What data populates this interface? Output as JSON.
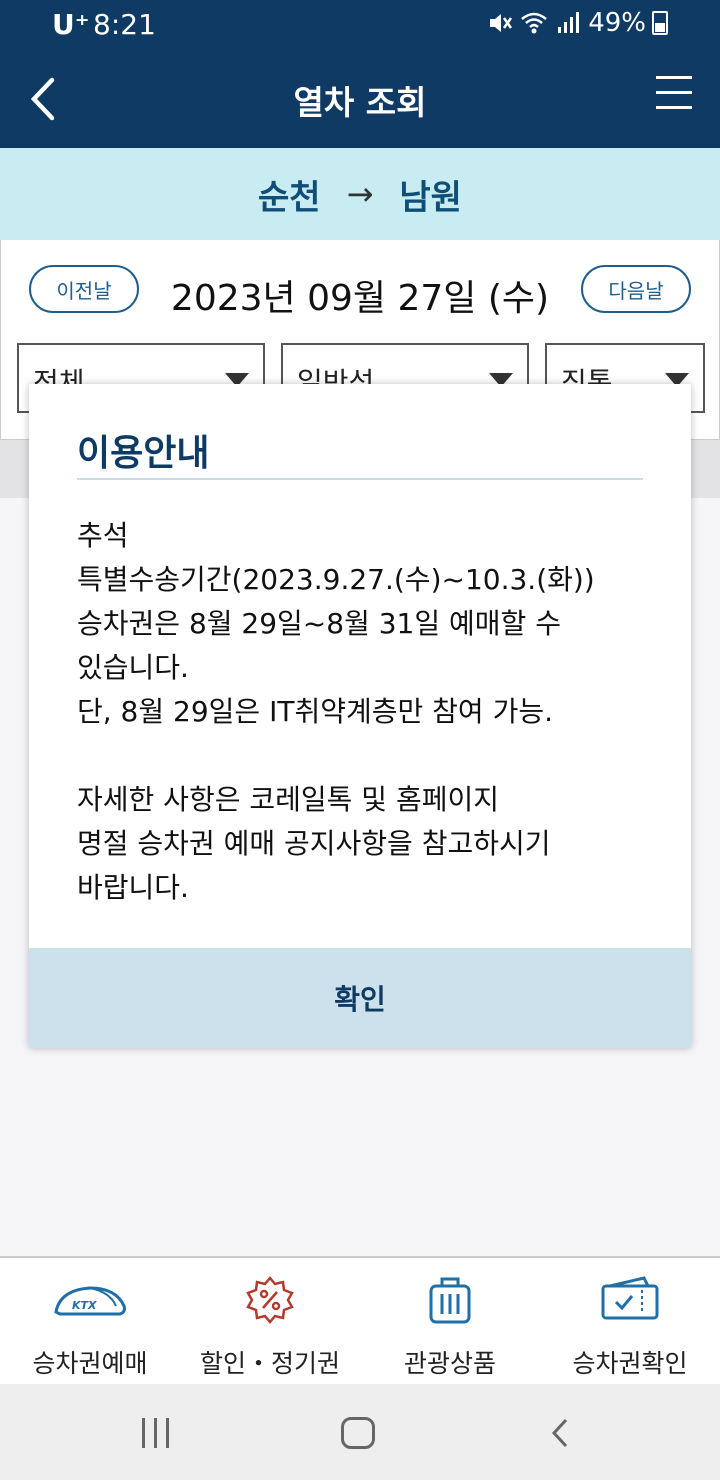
{
  "status_bar": {
    "carrier": "U⁺",
    "time": "8:21",
    "battery": "49%"
  },
  "header": {
    "title": "열차 조회"
  },
  "route": {
    "from": "순천",
    "arrow": "→",
    "to": "남원"
  },
  "date_panel": {
    "prev_label": "이전날",
    "date": "2023년 09월 27일 (수)",
    "next_label": "다음날",
    "filters": [
      {
        "label": "전체"
      },
      {
        "label": "일반석"
      },
      {
        "label": "직통"
      }
    ]
  },
  "dialog": {
    "title": "이용안내",
    "lines": [
      "추석",
      "특별수송기간(2023.9.27.(수)~10.3.(화))",
      "승차권은 8월 29일~8월 31일 예매할 수",
      "있습니다.",
      "단, 8월 29일은 IT취약계층만 참여 가능.",
      "",
      "자세한 사항은 코레일톡 및 홈페이지",
      "명절 승차권 예매 공지사항을 참고하시기",
      "바랍니다."
    ],
    "confirm_label": "확인"
  },
  "bottom_nav": {
    "items": [
      {
        "label": "승차권예매",
        "icon": "ktx-train-icon",
        "badge": "KTX"
      },
      {
        "label": "할인・정기권",
        "icon": "discount-icon"
      },
      {
        "label": "관광상품",
        "icon": "luggage-icon"
      },
      {
        "label": "승차권확인",
        "icon": "ticket-check-icon"
      }
    ]
  },
  "colors": {
    "header_bg": "#0e3a63",
    "route_bg": "#c9ecf3",
    "confirm_bg": "#cde1ec",
    "accent": "#1f5e8c",
    "discount_red": "#b23a2e"
  }
}
